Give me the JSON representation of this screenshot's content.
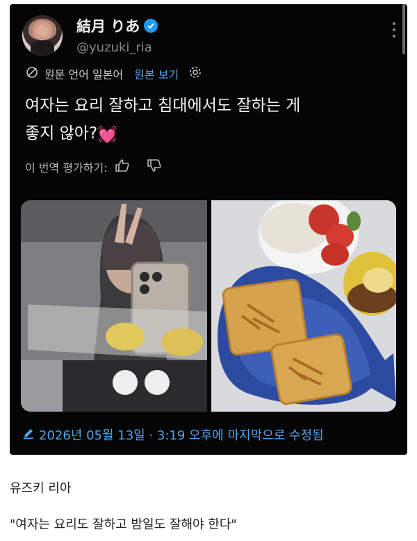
{
  "tweet": {
    "display_name": "結月 りあ",
    "handle": "@yuzuki_ria",
    "translation_label": "원문 언어 일본어",
    "show_original_label": "원본 보기",
    "text_line1": "여자는 요리 잘하고 침대에서도 잘하는 게",
    "text_line2": "좋지 않아?",
    "text_emoji": "💓",
    "rate_label": "이 번역 평가하기:",
    "edited_timestamp": "2026년 05월 13일 · 3:19 오후에 마지막으로 수정됨"
  },
  "caption": {
    "author": "유즈키 리아",
    "quote": "\"여자는 요리도 잘하고 밤일도 잘해야 한다\""
  },
  "icons": {
    "verified": "verified-badge-icon",
    "more": "more-vertical-icon",
    "translate": "translate-icon",
    "settings": "gear-icon",
    "thumbs_up": "thumbs-up-icon",
    "thumbs_down": "thumbs-down-icon",
    "edit": "pencil-icon"
  },
  "colors": {
    "tweet_bg": "#050505",
    "accent": "#4ea6f0",
    "verified": "#1d9bf0",
    "text_primary": "#f4f4f4",
    "text_secondary": "#8a8a8a"
  }
}
